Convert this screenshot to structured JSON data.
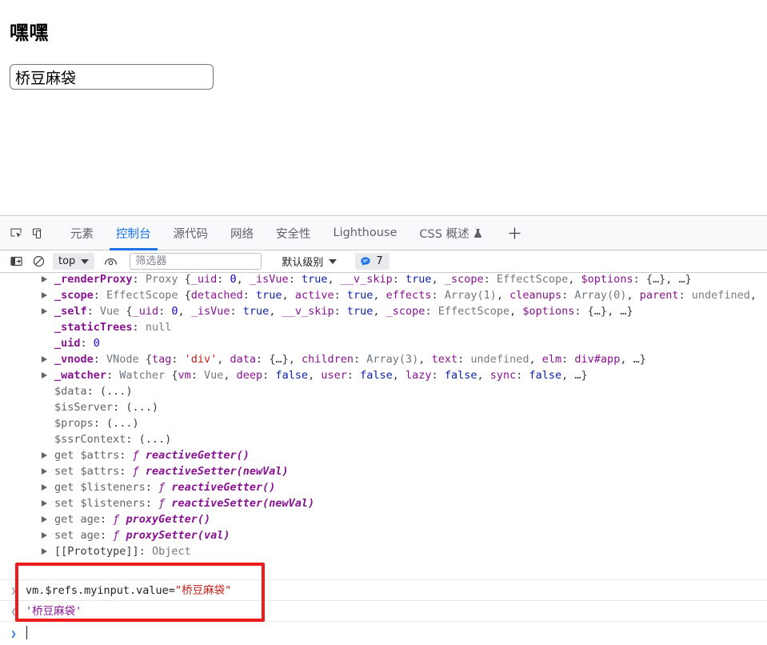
{
  "page": {
    "title": "嘿嘿",
    "input_value": "桥豆麻袋",
    "input_placeholder": ""
  },
  "devtools": {
    "left_icons": [
      {
        "name": "inspect-element-icon",
        "label": "inspect-element"
      },
      {
        "name": "device-toolbar-icon",
        "label": "device-toolbar"
      }
    ],
    "tabs": [
      {
        "label": "元素",
        "active": false
      },
      {
        "label": "控制台",
        "active": true
      },
      {
        "label": "源代码",
        "active": false
      },
      {
        "label": "网络",
        "active": false
      },
      {
        "label": "安全性",
        "active": false
      },
      {
        "label": "Lighthouse",
        "active": false
      },
      {
        "label": "CSS 概述",
        "active": false,
        "experimental": true
      }
    ],
    "add_tab_label": "+",
    "console_toolbar": {
      "sidebar_toggle": "console-sidebar",
      "clear_console": "clear-console",
      "context": "top",
      "eye_icon": "live-expression",
      "filter_placeholder": "筛选器",
      "filter_value": "",
      "level": "默认级别",
      "issues_count": "7"
    },
    "console_input": {
      "command": "vm.$refs.myinput.value=",
      "command_string": "\"桥豆麻袋\"",
      "result": "'桥豆麻袋'",
      "prompt_symbol": "❯",
      "in_symbol": "❯",
      "out_symbol": "❮"
    },
    "object_lines": [
      {
        "triangle": true,
        "parts": [
          {
            "t": "_renderProxy",
            "c": "k"
          },
          {
            "t": ": ",
            "c": "punct"
          },
          {
            "t": "Proxy ",
            "c": "cls"
          },
          {
            "t": "{",
            "c": "punct"
          },
          {
            "t": "_uid",
            "c": "k2"
          },
          {
            "t": ": ",
            "c": "punct"
          },
          {
            "t": "0",
            "c": "num"
          },
          {
            "t": ", ",
            "c": "punct"
          },
          {
            "t": "_isVue",
            "c": "k2"
          },
          {
            "t": ": ",
            "c": "punct"
          },
          {
            "t": "true",
            "c": "bool"
          },
          {
            "t": ", ",
            "c": "punct"
          },
          {
            "t": "__v_skip",
            "c": "k2"
          },
          {
            "t": ": ",
            "c": "punct"
          },
          {
            "t": "true",
            "c": "bool"
          },
          {
            "t": ", ",
            "c": "punct"
          },
          {
            "t": "_scope",
            "c": "k2"
          },
          {
            "t": ": ",
            "c": "punct"
          },
          {
            "t": "EffectScope",
            "c": "cls"
          },
          {
            "t": ", ",
            "c": "punct"
          },
          {
            "t": "$options",
            "c": "k2"
          },
          {
            "t": ": ",
            "c": "punct"
          },
          {
            "t": "{…}",
            "c": "punct"
          },
          {
            "t": ", …}",
            "c": "punct"
          }
        ]
      },
      {
        "triangle": true,
        "parts": [
          {
            "t": "_scope",
            "c": "k"
          },
          {
            "t": ": ",
            "c": "punct"
          },
          {
            "t": "EffectScope ",
            "c": "cls"
          },
          {
            "t": "{",
            "c": "punct"
          },
          {
            "t": "detached",
            "c": "k2"
          },
          {
            "t": ": ",
            "c": "punct"
          },
          {
            "t": "true",
            "c": "bool"
          },
          {
            "t": ", ",
            "c": "punct"
          },
          {
            "t": "active",
            "c": "k2"
          },
          {
            "t": ": ",
            "c": "punct"
          },
          {
            "t": "true",
            "c": "bool"
          },
          {
            "t": ", ",
            "c": "punct"
          },
          {
            "t": "effects",
            "c": "k2"
          },
          {
            "t": ": ",
            "c": "punct"
          },
          {
            "t": "Array(1)",
            "c": "cls"
          },
          {
            "t": ", ",
            "c": "punct"
          },
          {
            "t": "cleanups",
            "c": "k2"
          },
          {
            "t": ": ",
            "c": "punct"
          },
          {
            "t": "Array(0)",
            "c": "cls"
          },
          {
            "t": ", ",
            "c": "punct"
          },
          {
            "t": "parent",
            "c": "k2"
          },
          {
            "t": ": ",
            "c": "punct"
          },
          {
            "t": "undefined",
            "c": "undef"
          },
          {
            "t": ",",
            "c": "punct"
          }
        ]
      },
      {
        "triangle": true,
        "parts": [
          {
            "t": "_self",
            "c": "k"
          },
          {
            "t": ": ",
            "c": "punct"
          },
          {
            "t": "Vue ",
            "c": "cls"
          },
          {
            "t": "{",
            "c": "punct"
          },
          {
            "t": "_uid",
            "c": "k2"
          },
          {
            "t": ": ",
            "c": "punct"
          },
          {
            "t": "0",
            "c": "num"
          },
          {
            "t": ", ",
            "c": "punct"
          },
          {
            "t": "_isVue",
            "c": "k2"
          },
          {
            "t": ": ",
            "c": "punct"
          },
          {
            "t": "true",
            "c": "bool"
          },
          {
            "t": ", ",
            "c": "punct"
          },
          {
            "t": "__v_skip",
            "c": "k2"
          },
          {
            "t": ": ",
            "c": "punct"
          },
          {
            "t": "true",
            "c": "bool"
          },
          {
            "t": ", ",
            "c": "punct"
          },
          {
            "t": "_scope",
            "c": "k2"
          },
          {
            "t": ": ",
            "c": "punct"
          },
          {
            "t": "EffectScope",
            "c": "cls"
          },
          {
            "t": ", ",
            "c": "punct"
          },
          {
            "t": "$options",
            "c": "k2"
          },
          {
            "t": ": ",
            "c": "punct"
          },
          {
            "t": "{…}",
            "c": "punct"
          },
          {
            "t": ", …}",
            "c": "punct"
          }
        ]
      },
      {
        "triangle": false,
        "parts": [
          {
            "t": "_staticTrees",
            "c": "k"
          },
          {
            "t": ": ",
            "c": "punct"
          },
          {
            "t": "null",
            "c": "nul"
          }
        ]
      },
      {
        "triangle": false,
        "parts": [
          {
            "t": "_uid",
            "c": "k"
          },
          {
            "t": ": ",
            "c": "punct"
          },
          {
            "t": "0",
            "c": "num"
          }
        ]
      },
      {
        "triangle": true,
        "parts": [
          {
            "t": "_vnode",
            "c": "k"
          },
          {
            "t": ": ",
            "c": "punct"
          },
          {
            "t": "VNode ",
            "c": "cls"
          },
          {
            "t": "{",
            "c": "punct"
          },
          {
            "t": "tag",
            "c": "k2"
          },
          {
            "t": ": ",
            "c": "punct"
          },
          {
            "t": "'div'",
            "c": "str"
          },
          {
            "t": ", ",
            "c": "punct"
          },
          {
            "t": "data",
            "c": "k2"
          },
          {
            "t": ": ",
            "c": "punct"
          },
          {
            "t": "{…}",
            "c": "punct"
          },
          {
            "t": ", ",
            "c": "punct"
          },
          {
            "t": "children",
            "c": "k2"
          },
          {
            "t": ": ",
            "c": "punct"
          },
          {
            "t": "Array(3)",
            "c": "cls"
          },
          {
            "t": ", ",
            "c": "punct"
          },
          {
            "t": "text",
            "c": "k2"
          },
          {
            "t": ": ",
            "c": "punct"
          },
          {
            "t": "undefined",
            "c": "undef"
          },
          {
            "t": ", ",
            "c": "punct"
          },
          {
            "t": "elm",
            "c": "k2"
          },
          {
            "t": ": ",
            "c": "punct"
          },
          {
            "t": "div#app",
            "c": "k2"
          },
          {
            "t": ", …}",
            "c": "punct"
          }
        ]
      },
      {
        "triangle": true,
        "parts": [
          {
            "t": "_watcher",
            "c": "k"
          },
          {
            "t": ": ",
            "c": "punct"
          },
          {
            "t": "Watcher ",
            "c": "cls"
          },
          {
            "t": "{",
            "c": "punct"
          },
          {
            "t": "vm",
            "c": "k2"
          },
          {
            "t": ": ",
            "c": "punct"
          },
          {
            "t": "Vue",
            "c": "cls"
          },
          {
            "t": ", ",
            "c": "punct"
          },
          {
            "t": "deep",
            "c": "k2"
          },
          {
            "t": ": ",
            "c": "punct"
          },
          {
            "t": "false",
            "c": "bool"
          },
          {
            "t": ", ",
            "c": "punct"
          },
          {
            "t": "user",
            "c": "k2"
          },
          {
            "t": ": ",
            "c": "punct"
          },
          {
            "t": "false",
            "c": "bool"
          },
          {
            "t": ", ",
            "c": "punct"
          },
          {
            "t": "lazy",
            "c": "k2"
          },
          {
            "t": ": ",
            "c": "punct"
          },
          {
            "t": "false",
            "c": "bool"
          },
          {
            "t": ", ",
            "c": "punct"
          },
          {
            "t": "sync",
            "c": "k2"
          },
          {
            "t": ": ",
            "c": "punct"
          },
          {
            "t": "false",
            "c": "bool"
          },
          {
            "t": ", …}",
            "c": "punct"
          }
        ]
      },
      {
        "triangle": false,
        "parts": [
          {
            "t": "$data",
            "c": "kplain"
          },
          {
            "t": ": ",
            "c": "punct"
          },
          {
            "t": "(...)",
            "c": "punct"
          }
        ]
      },
      {
        "triangle": false,
        "parts": [
          {
            "t": "$isServer",
            "c": "kplain"
          },
          {
            "t": ": ",
            "c": "punct"
          },
          {
            "t": "(...)",
            "c": "punct"
          }
        ]
      },
      {
        "triangle": false,
        "parts": [
          {
            "t": "$props",
            "c": "kplain"
          },
          {
            "t": ": ",
            "c": "punct"
          },
          {
            "t": "(...)",
            "c": "punct"
          }
        ]
      },
      {
        "triangle": false,
        "parts": [
          {
            "t": "$ssrContext",
            "c": "kplain"
          },
          {
            "t": ": ",
            "c": "punct"
          },
          {
            "t": "(...)",
            "c": "punct"
          }
        ]
      },
      {
        "triangle": true,
        "parts": [
          {
            "t": "get ",
            "c": "fnkw"
          },
          {
            "t": "$attrs",
            "c": "kplain"
          },
          {
            "t": ": ",
            "c": "punct"
          },
          {
            "t": "ƒ ",
            "c": "fnsym"
          },
          {
            "t": "reactiveGetter()",
            "c": "fnname"
          }
        ]
      },
      {
        "triangle": true,
        "parts": [
          {
            "t": "set ",
            "c": "fnkw"
          },
          {
            "t": "$attrs",
            "c": "kplain"
          },
          {
            "t": ": ",
            "c": "punct"
          },
          {
            "t": "ƒ ",
            "c": "fnsym"
          },
          {
            "t": "reactiveSetter(newVal)",
            "c": "fnname"
          }
        ]
      },
      {
        "triangle": true,
        "parts": [
          {
            "t": "get ",
            "c": "fnkw"
          },
          {
            "t": "$listeners",
            "c": "kplain"
          },
          {
            "t": ": ",
            "c": "punct"
          },
          {
            "t": "ƒ ",
            "c": "fnsym"
          },
          {
            "t": "reactiveGetter()",
            "c": "fnname"
          }
        ]
      },
      {
        "triangle": true,
        "parts": [
          {
            "t": "set ",
            "c": "fnkw"
          },
          {
            "t": "$listeners",
            "c": "kplain"
          },
          {
            "t": ": ",
            "c": "punct"
          },
          {
            "t": "ƒ ",
            "c": "fnsym"
          },
          {
            "t": "reactiveSetter(newVal)",
            "c": "fnname"
          }
        ]
      },
      {
        "triangle": true,
        "parts": [
          {
            "t": "get ",
            "c": "fnkw"
          },
          {
            "t": "age",
            "c": "kplain"
          },
          {
            "t": ": ",
            "c": "punct"
          },
          {
            "t": "ƒ ",
            "c": "fnsym"
          },
          {
            "t": "proxyGetter()",
            "c": "fnname"
          }
        ]
      },
      {
        "triangle": true,
        "parts": [
          {
            "t": "set ",
            "c": "fnkw"
          },
          {
            "t": "age",
            "c": "kplain"
          },
          {
            "t": ": ",
            "c": "punct"
          },
          {
            "t": "ƒ ",
            "c": "fnsym"
          },
          {
            "t": "proxySetter(val)",
            "c": "fnname"
          }
        ]
      },
      {
        "triangle": true,
        "parts": [
          {
            "t": "[[Prototype]]",
            "c": "proto"
          },
          {
            "t": ": ",
            "c": "punct"
          },
          {
            "t": "Object",
            "c": "cls"
          }
        ]
      }
    ]
  },
  "annotation": {
    "highlight_color": "#ee1c1c"
  }
}
